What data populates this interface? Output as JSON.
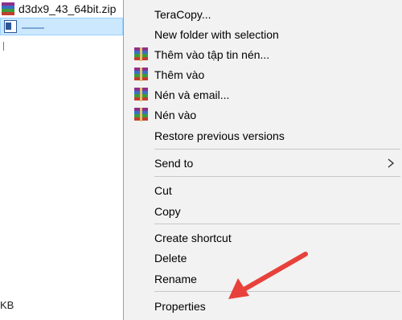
{
  "explorer": {
    "zip_file_name": "d3dx9_43_64bit.zip",
    "size_text": "KB"
  },
  "menu": {
    "items": [
      {
        "label": "TeraCopy...",
        "icon": null
      },
      {
        "label": "New folder with selection",
        "icon": null
      },
      {
        "label": "Thêm vào tập tin nén...",
        "icon": "winrar-icon"
      },
      {
        "label": "Thêm vào",
        "icon": "winrar-icon"
      },
      {
        "label": "Nén và email...",
        "icon": "winrar-icon"
      },
      {
        "label": "Nén vào",
        "icon": "winrar-icon"
      },
      {
        "label": "Restore previous versions",
        "icon": null
      },
      {
        "label": "Send to",
        "icon": null,
        "submenu": true
      },
      {
        "label": "Cut",
        "icon": null
      },
      {
        "label": "Copy",
        "icon": null
      },
      {
        "label": "Create shortcut",
        "icon": null
      },
      {
        "label": "Delete",
        "icon": null
      },
      {
        "label": "Rename",
        "icon": null
      },
      {
        "label": "Properties",
        "icon": null
      }
    ]
  },
  "colors": {
    "menu_background": "#f2f2f2",
    "selection_background": "#cce8ff",
    "annotation_arrow": "#e8413b"
  }
}
